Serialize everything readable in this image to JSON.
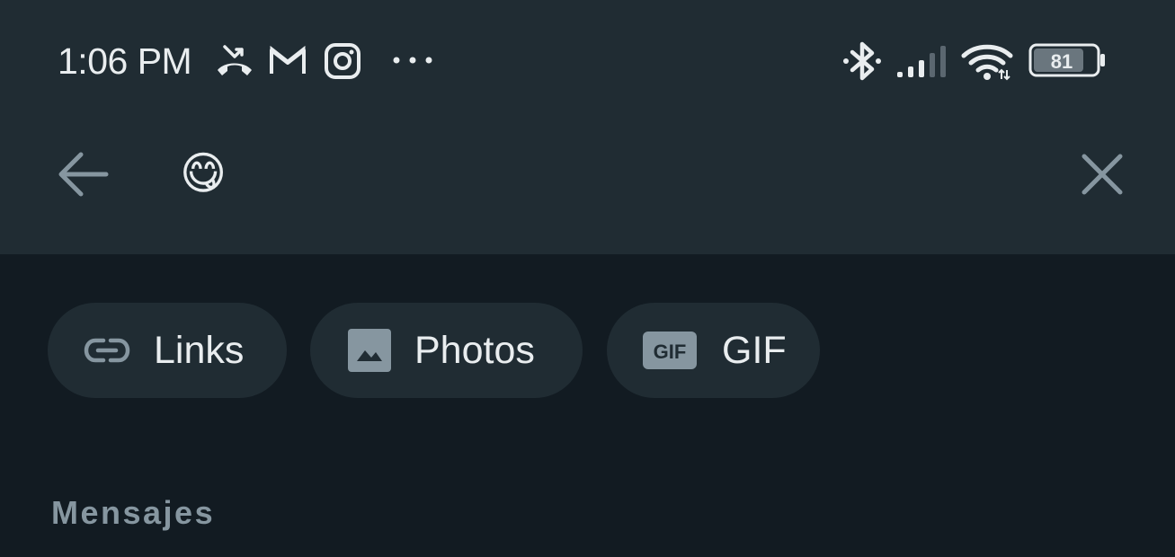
{
  "status_bar": {
    "time": "1:06 PM",
    "notification_icons": [
      "missed-call-icon",
      "gmail-icon",
      "instagram-icon",
      "more-dots-icon"
    ],
    "system_icons": [
      "bluetooth-icon",
      "signal-icon",
      "wifi-icon",
      "battery-icon"
    ],
    "battery_level": "81"
  },
  "search": {
    "query": "😋",
    "back_icon": "arrow-left-icon",
    "clear_icon": "close-icon"
  },
  "filters": [
    {
      "label": "Links",
      "icon": "link-icon"
    },
    {
      "label": "Photos",
      "icon": "image-icon"
    },
    {
      "label": "GIF",
      "icon": "gif-icon"
    }
  ],
  "section": {
    "title": "Mensajes"
  },
  "colors": {
    "header_bg": "#202c33",
    "body_bg": "#121b22",
    "text_primary": "#e9edef",
    "text_secondary": "#8696a0",
    "chip_bg": "#202c33"
  }
}
